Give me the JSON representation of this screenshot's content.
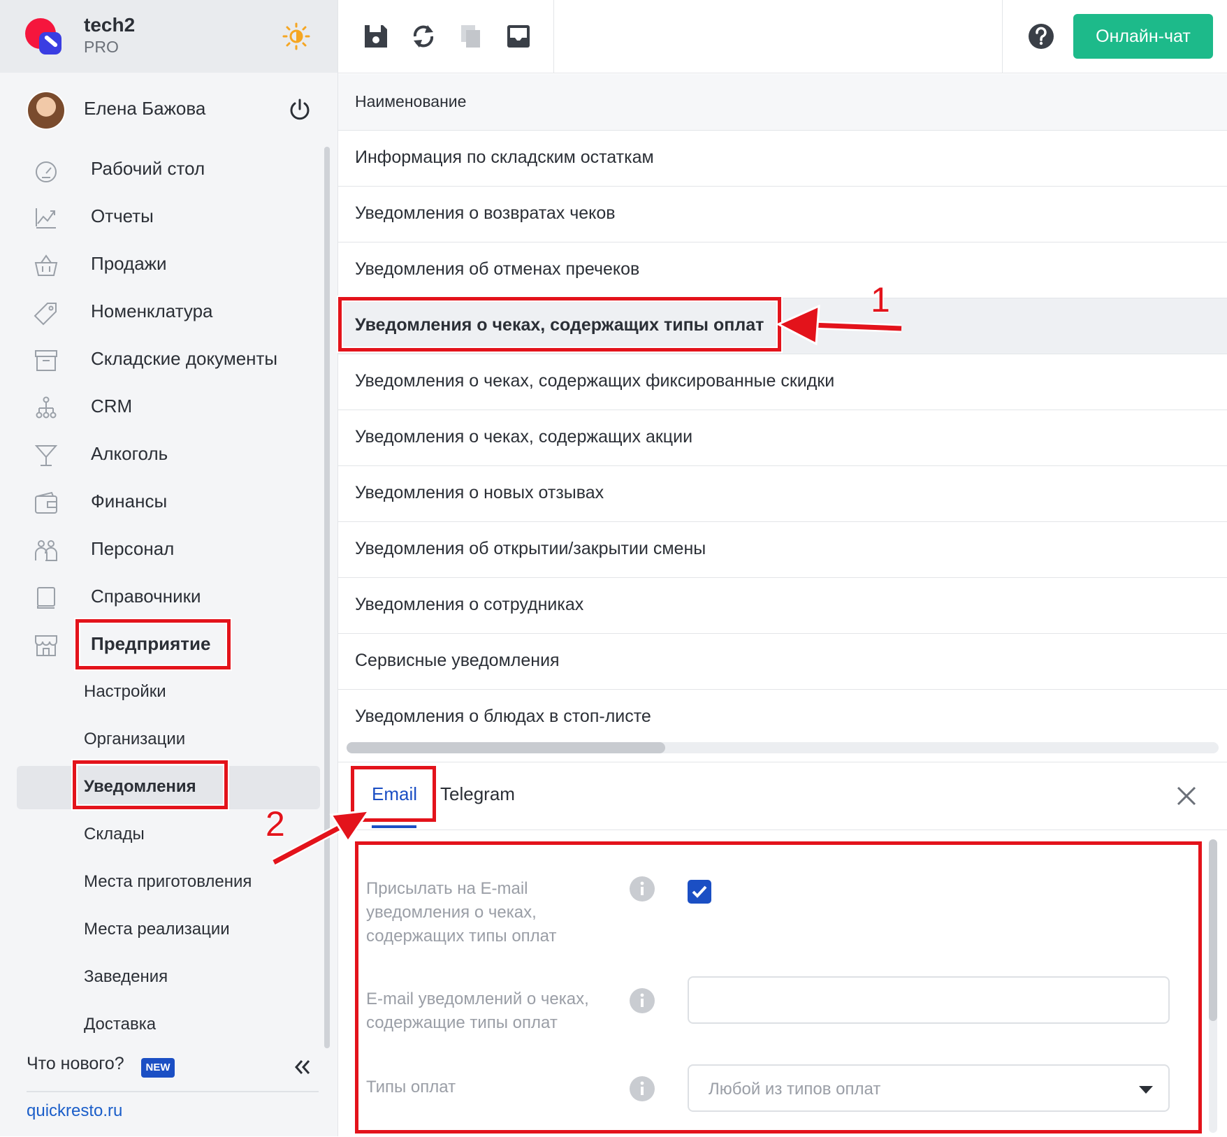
{
  "brand": {
    "name": "tech2",
    "plan": "PRO"
  },
  "user": {
    "name": "Елена Бажова"
  },
  "nav": {
    "items": [
      {
        "label": "Рабочий стол",
        "icon": "dashboard-icon"
      },
      {
        "label": "Отчеты",
        "icon": "chart-icon"
      },
      {
        "label": "Продажи",
        "icon": "basket-icon"
      },
      {
        "label": "Номенклатура",
        "icon": "tag-icon"
      },
      {
        "label": "Складские документы",
        "icon": "archive-icon"
      },
      {
        "label": "CRM",
        "icon": "hierarchy-icon"
      },
      {
        "label": "Алкоголь",
        "icon": "cocktail-icon"
      },
      {
        "label": "Финансы",
        "icon": "wallet-icon"
      },
      {
        "label": "Персонал",
        "icon": "people-icon"
      },
      {
        "label": "Справочники",
        "icon": "book-icon"
      },
      {
        "label": "Предприятие",
        "icon": "store-icon"
      }
    ],
    "sub_items": [
      {
        "label": "Настройки"
      },
      {
        "label": "Организации"
      },
      {
        "label": "Уведомления"
      },
      {
        "label": "Склады"
      },
      {
        "label": "Места приготовления"
      },
      {
        "label": "Места реализации"
      },
      {
        "label": "Заведения"
      },
      {
        "label": "Доставка"
      }
    ],
    "whats_new": "Что нового?",
    "new_badge": "NEW",
    "site_link": "quickresto.ru"
  },
  "toolbar": {
    "icons": [
      "save-icon",
      "refresh-icon",
      "copy-icon",
      "inbox-icon"
    ],
    "chat_label": "Онлайн-чат"
  },
  "list": {
    "header": "Наименование",
    "rows": [
      "Информация по складским остаткам",
      "Уведомления о возвратах чеков",
      "Уведомления об отменах пречеков",
      "Уведомления о чеках, содержащих типы оплат",
      "Уведомления о чеках, содержащих фиксированные скидки",
      "Уведомления о чеках, содержащих акции",
      "Уведомления о новых отзывах",
      "Уведомления об открытии/закрытии смены",
      "Уведомления о сотрудниках",
      "Сервисные уведомления",
      "Уведомления о блюдах в стоп-листе"
    ],
    "selected_index": 3
  },
  "detail": {
    "tabs": [
      "Email",
      "Telegram"
    ],
    "active_tab": "Email",
    "send_label": "Присылать на E-mail уведомления о чеках, содержащих типы оплат",
    "send_checked": true,
    "email_label": "E-mail уведомлений о чеках, содержащие типы оплат",
    "email_value": "",
    "payment_label": "Типы оплат",
    "payment_value": "Любой из типов оплат"
  },
  "annotations": {
    "marker1": "1",
    "marker2": "2"
  },
  "colors": {
    "accent": "#1b4fc4",
    "chat_button": "#1dba8a",
    "annotation": "#e3131b",
    "brand_red": "#f5163d"
  }
}
